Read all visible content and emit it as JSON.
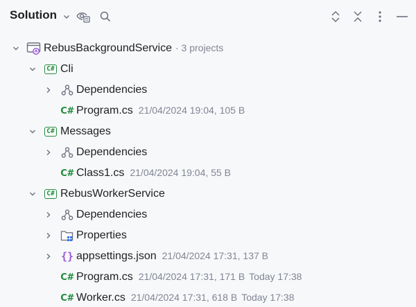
{
  "header": {
    "title": "Solution",
    "icons": [
      "chevron-down-icon",
      "eye-settings-icon",
      "search-icon",
      "expand-all-icon",
      "collapse-all-icon",
      "more-options-icon",
      "minimize-icon"
    ]
  },
  "tree": {
    "root": {
      "label": "RebusBackgroundService",
      "meta": "· 3 projects"
    },
    "projects": [
      {
        "label": "Cli",
        "deps_label": "Dependencies",
        "files": [
          {
            "name": "Program.cs",
            "meta": "21/04/2024 19:04, 105 B"
          }
        ]
      },
      {
        "label": "Messages",
        "deps_label": "Dependencies",
        "files": [
          {
            "name": "Class1.cs",
            "meta": "21/04/2024 19:04, 55 B"
          }
        ]
      },
      {
        "label": "RebusWorkerService",
        "deps_label": "Dependencies",
        "properties_label": "Properties",
        "appsettings": {
          "name": "appsettings.json",
          "meta": "21/04/2024 17:31, 137 B"
        },
        "files": [
          {
            "name": "Program.cs",
            "meta": "21/04/2024 17:31, 171 B",
            "modified": "Today 17:38"
          },
          {
            "name": "Worker.cs",
            "meta": "21/04/2024 17:31, 618 B",
            "modified": "Today 17:38"
          }
        ]
      }
    ],
    "badges": {
      "csproj": "C#",
      "csfile": "C#",
      "json": "{}"
    }
  },
  "colors": {
    "csharp_green": "#208a3c",
    "meta_gray": "#818594",
    "json_purple": "#9a59d6",
    "background": "#f7f8fa"
  }
}
